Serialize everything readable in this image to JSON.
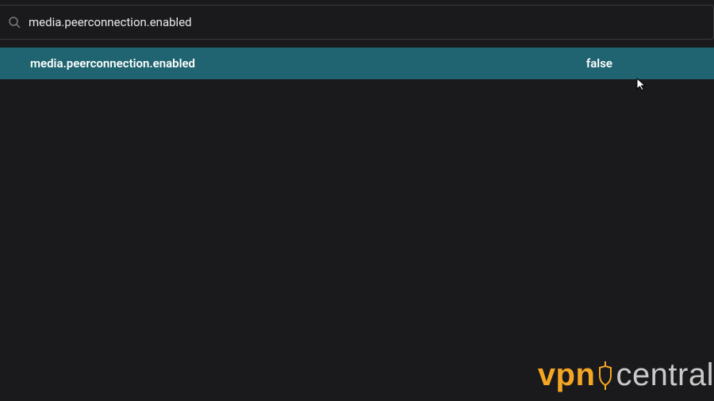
{
  "search": {
    "value": "media.peerconnection.enabled",
    "placeholder": ""
  },
  "pref": {
    "name": "media.peerconnection.enabled",
    "value": "false"
  },
  "watermark": {
    "brand_a": "vpn",
    "brand_b": "central"
  },
  "colors": {
    "row_highlight": "#1f6470",
    "accent": "#f5a623",
    "background": "#1a1a1d"
  }
}
